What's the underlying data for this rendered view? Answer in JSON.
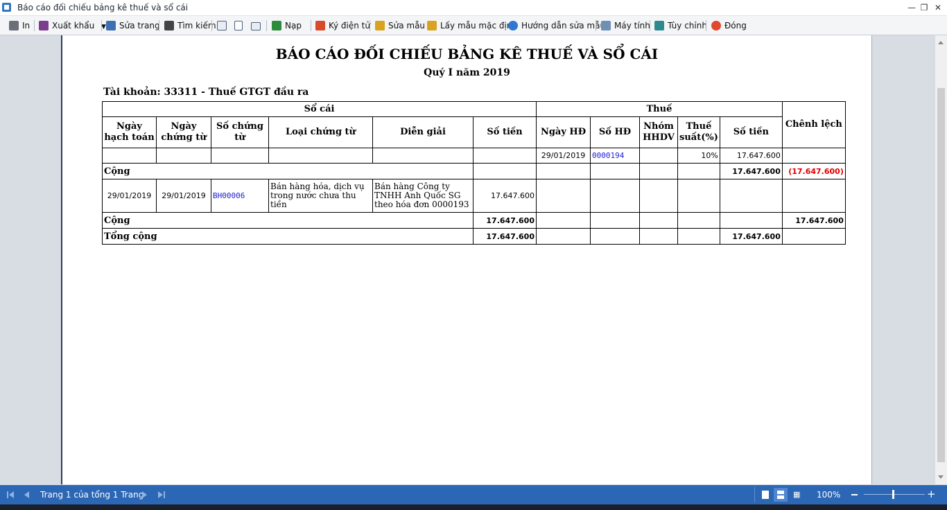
{
  "window": {
    "title": "Báo cáo đối chiếu bảng kê thuế và sổ cái"
  },
  "toolbar": {
    "print": "In",
    "export": "Xuất khẩu",
    "edit_page": "Sửa trang",
    "search": "Tìm kiếm",
    "reload": "Nạp",
    "esign": "Ký điện tử",
    "edit_template": "Sửa mẫu",
    "default_template": "Lấy mẫu mặc định",
    "guide": "Hướng dẫn sửa mẫu",
    "calculator": "Máy tính",
    "customize": "Tùy chỉnh",
    "close": "Đóng"
  },
  "report": {
    "title": "BÁO CÁO ĐỐI CHIẾU BẢNG KÊ THUẾ VÀ SỔ CÁI",
    "subtitle": "Quý I năm 2019",
    "account": "Tài khoản: 33311 - Thuế GTGT đầu ra",
    "headers": {
      "ledger": "Sổ cái",
      "tax": "Thuế",
      "difference": "Chênh lệch",
      "posting_date": "Ngày hạch toán",
      "voucher_date": "Ngày chứng từ",
      "voucher_no": "Số chứng từ",
      "voucher_type": "Loại chứng từ",
      "description": "Diễn giải",
      "amount": "Số tiền",
      "invoice_date": "Ngày HĐ",
      "invoice_no": "Số HĐ",
      "goods_group": "Nhóm HHDV",
      "tax_rate": "Thuế suất(%)",
      "tax_amount": "Số tiền"
    },
    "tax_row": {
      "invoice_date": "29/01/2019",
      "invoice_no": "0000194",
      "tax_rate": "10%",
      "amount": "17.647.600"
    },
    "tax_total": {
      "label": "Cộng",
      "amount": "17.647.600",
      "difference": "(17.647.600)"
    },
    "ledger_row": {
      "posting_date": "29/01/2019",
      "voucher_date": "29/01/2019",
      "voucher_no": "BH00006",
      "voucher_type": "Bán hàng hóa, dịch vụ trong nước chưa thu tiền",
      "description": "Bán hàng Công ty TNHH Anh Quốc SG theo hóa đơn 0000193",
      "amount": "17.647.600"
    },
    "ledger_total": {
      "label": "Cộng",
      "amount": "17.647.600",
      "difference": "17.647.600"
    },
    "grand_total": {
      "label": "Tổng cộng",
      "ledger_amount": "17.647.600",
      "tax_amount": "17.647.600"
    }
  },
  "statusbar": {
    "page_info": "Trang 1 của tổng 1 Trang",
    "zoom": "100%"
  },
  "colors": {
    "status_bar": "#2c67b5",
    "negative": "#e00000",
    "link": "#1b1bd6"
  }
}
